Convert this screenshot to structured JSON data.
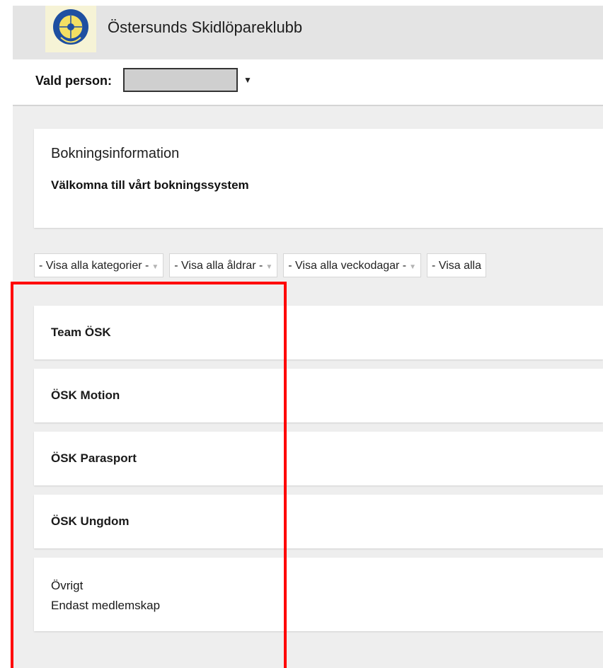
{
  "header": {
    "title": "Östersunds Skidlöpareklubb",
    "logo_icon": "club-logo"
  },
  "person": {
    "label": "Vald person:",
    "selected_value": ""
  },
  "info": {
    "title": "Bokningsinformation",
    "subtitle": "Välkomna till vårt bokningssystem"
  },
  "filters": [
    {
      "label": "- Visa alla kategorier -"
    },
    {
      "label": "- Visa alla åldrar -"
    },
    {
      "label": "- Visa alla veckodagar -"
    },
    {
      "label": "- Visa alla"
    }
  ],
  "categories": [
    {
      "name": "Team ÖSK"
    },
    {
      "name": "ÖSK Motion"
    },
    {
      "name": "ÖSK Parasport"
    },
    {
      "name": "ÖSK Ungdom"
    },
    {
      "name": "Övrigt",
      "description": "Endast medlemskap"
    }
  ],
  "colors": {
    "highlight": "#ff0000",
    "header_bg": "#e4e4e4",
    "content_bg": "#eeeeee"
  }
}
